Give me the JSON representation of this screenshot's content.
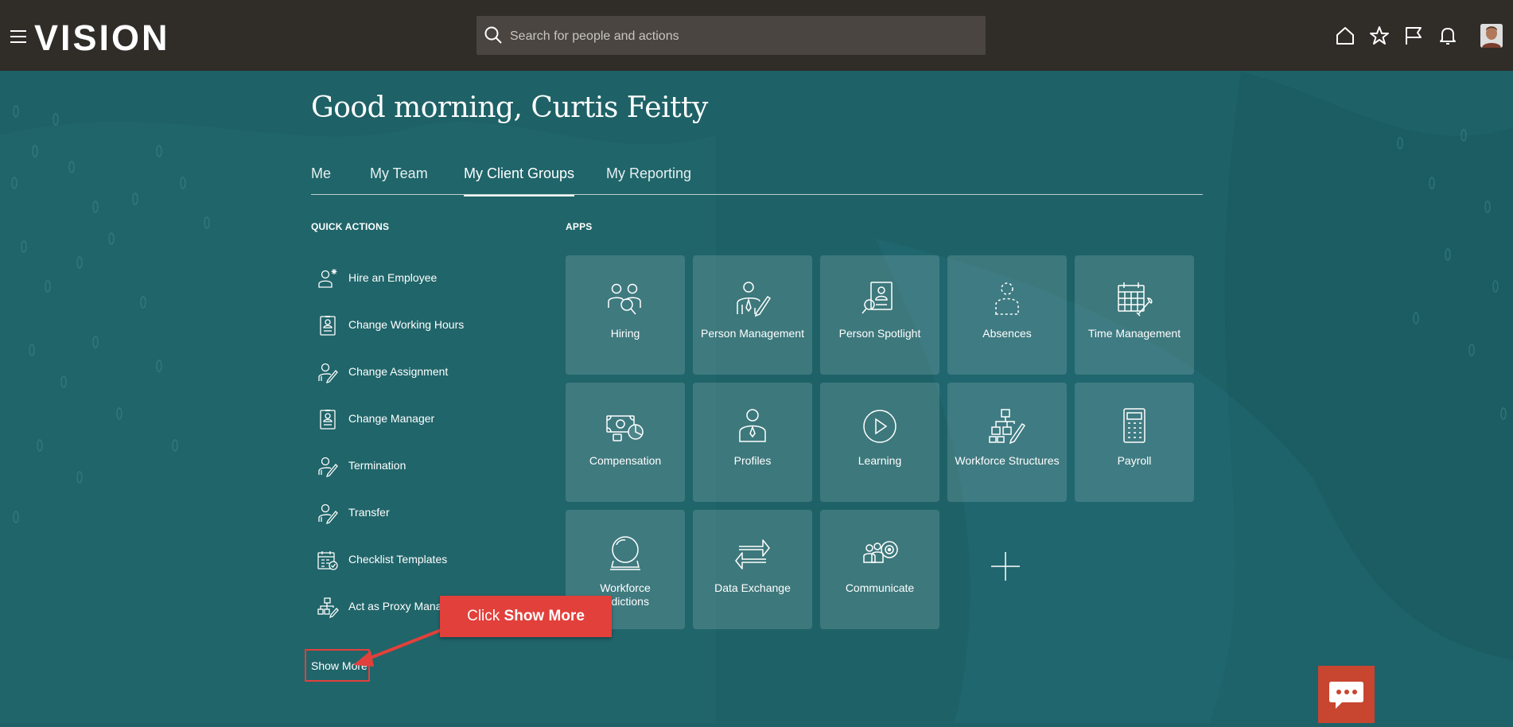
{
  "header": {
    "logo": "VISION",
    "search_placeholder": "Search for people and actions"
  },
  "greeting": "Good morning, Curtis Feitty",
  "tabs": [
    {
      "label": "Me"
    },
    {
      "label": "My Team"
    },
    {
      "label": "My Client Groups"
    },
    {
      "label": "My Reporting"
    }
  ],
  "active_tab": "My Client Groups",
  "quick_actions": {
    "title": "QUICK ACTIONS",
    "items": [
      {
        "label": "Hire an Employee",
        "icon": "hire-icon"
      },
      {
        "label": "Change Working Hours",
        "icon": "badge-icon"
      },
      {
        "label": "Change Assignment",
        "icon": "person-edit-icon"
      },
      {
        "label": "Change Manager",
        "icon": "badge-icon"
      },
      {
        "label": "Termination",
        "icon": "person-edit-icon"
      },
      {
        "label": "Transfer",
        "icon": "person-edit-icon"
      },
      {
        "label": "Checklist Templates",
        "icon": "calendar-check-icon"
      },
      {
        "label": "Act as Proxy Manag",
        "icon": "org-chart-icon"
      }
    ],
    "show_more": "Show More"
  },
  "apps": {
    "title": "APPS",
    "tiles": [
      {
        "label": "Hiring",
        "icon": "hiring-icon"
      },
      {
        "label": "Person Management",
        "icon": "person-management-icon"
      },
      {
        "label": "Person Spotlight",
        "icon": "person-spotlight-icon"
      },
      {
        "label": "Absences",
        "icon": "absences-icon"
      },
      {
        "label": "Time Management",
        "icon": "time-management-icon"
      },
      {
        "label": "Compensation",
        "icon": "compensation-icon"
      },
      {
        "label": "Profiles",
        "icon": "profiles-icon"
      },
      {
        "label": "Learning",
        "icon": "learning-icon"
      },
      {
        "label": "Workforce Structures",
        "icon": "workforce-structures-icon"
      },
      {
        "label": "Payroll",
        "icon": "payroll-icon"
      },
      {
        "label": "Workforce\nPredictions",
        "display": "Workforce\nredictions",
        "icon": "crystal-ball-icon"
      },
      {
        "label": "Data Exchange",
        "icon": "data-exchange-icon"
      },
      {
        "label": "Communicate",
        "icon": "communicate-icon"
      }
    ]
  },
  "annotation": {
    "prefix": "Click ",
    "bold": "Show More"
  },
  "colors": {
    "topbar": "#302c28",
    "background": "#1e6267",
    "annotation_red": "#e2403b",
    "chat_button": "#c84530"
  }
}
